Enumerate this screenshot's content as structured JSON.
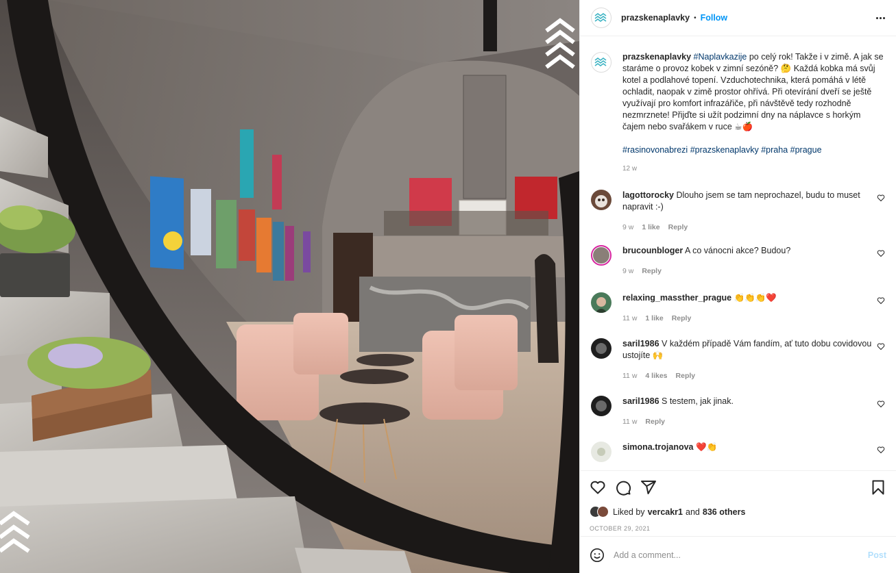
{
  "post": {
    "author": "prazskenaplavky",
    "separator": "•",
    "follow_label": "Follow",
    "caption": {
      "author": "prazskenaplavky",
      "hashtag_lead": "#Naplavkazije",
      "text": " po celý rok! Takže i v zimě. A jak se staráme o provoz kobek v zimní sezóně? 🤔 Každá kobka má svůj kotel a podlahové topení. Vzduchotechnika, která pomáhá v létě ochladit, naopak v zimě prostor ohřívá. Při otevírání dveří se ještě využívají pro komfort infrazářiče, při návštěvě tedy rozhodně nezmrznete! Přijďte si užít podzimní dny na náplavce s horkým čajem nebo svařákem v ruce ☕🍎",
      "tags": [
        "#rasinovonabrezi",
        "#prazskenaplavky",
        "#praha",
        "#prague"
      ],
      "time": "12 w"
    },
    "comments": [
      {
        "user": "lagottorocky",
        "text": "Dlouho jsem se tam neprochazel, budu to muset napravit :-)",
        "time": "9 w",
        "likes": "1 like",
        "reply": "Reply"
      },
      {
        "user": "brucounbloger",
        "text": "A co vánocni akce? Budou?",
        "time": "9 w",
        "likes": "",
        "reply": "Reply"
      },
      {
        "user": "relaxing_massther_prague",
        "text": "👏👏👏❤️",
        "time": "11 w",
        "likes": "1 like",
        "reply": "Reply"
      },
      {
        "user": "saril1986",
        "text": "V každém případě Vám fandím, ať tuto dobu covidovou ustojíte 🙌",
        "time": "11 w",
        "likes": "4 likes",
        "reply": "Reply"
      },
      {
        "user": "saril1986",
        "text": "S testem, jak jinak.",
        "time": "11 w",
        "likes": "",
        "reply": "Reply"
      },
      {
        "user": "simona.trojanova",
        "text": "❤️👏",
        "time": "",
        "likes": "",
        "reply": ""
      }
    ],
    "liked_by_prefix": "Liked by",
    "liked_by_user": "vercakr1",
    "liked_by_and": "and",
    "liked_by_others": "836 others",
    "date": "OCTOBER 29, 2021",
    "comment_placeholder": "Add a comment...",
    "post_label": "Post"
  },
  "colors": {
    "accent": "#0095f6",
    "link": "#00376b",
    "muted": "#8e8e8e",
    "like_red": "#ed4956",
    "brand_teal": "#3bb3c3"
  },
  "icons": [
    "logo-wave-icon",
    "more-icon",
    "heart-icon",
    "comment-icon",
    "share-icon",
    "bookmark-icon",
    "emoji-icon"
  ]
}
